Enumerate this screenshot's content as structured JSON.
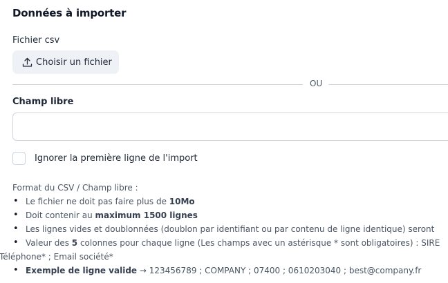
{
  "section": {
    "title": "Données à importer"
  },
  "file": {
    "label": "Fichier csv",
    "button_label": "Choisir un fichier",
    "button_icon": "upload-icon"
  },
  "divider": {
    "text": "OU"
  },
  "free_field": {
    "label": "Champ libre",
    "value": "",
    "placeholder": ""
  },
  "ignore_first_line": {
    "label": "Ignorer la première ligne de l'import",
    "checked": false
  },
  "help": {
    "intro": "Format du CSV / Champ libre :",
    "items": [
      {
        "before": "Le fichier ne doit pas faire plus de ",
        "strong": "10Mo",
        "after": ""
      },
      {
        "before": "Doit contenir au ",
        "strong": "maximum 1500 lignes",
        "after": ""
      },
      {
        "before": "Les lignes vides et doublonnées (doublon par identifiant ou par contenu de ligne identique) seront",
        "strong": "",
        "after": ""
      },
      {
        "before": "Valeur des ",
        "strong": "5",
        "after": " colonnes pour chaque ligne (Les champs avec un astérisque * sont obligatoires) : SIRE",
        "continuation": "Téléphone* ; Email société*"
      },
      {
        "before": "",
        "strong": "Exemple de ligne valide",
        "after": " → 123456789 ; COMPANY ; 07400 ; 0610203040 ; best@company.fr"
      }
    ]
  },
  "colors": {
    "button_bg": "#eef2f7",
    "border": "#d1d5db",
    "text": "#111827",
    "muted": "#4b5563"
  }
}
